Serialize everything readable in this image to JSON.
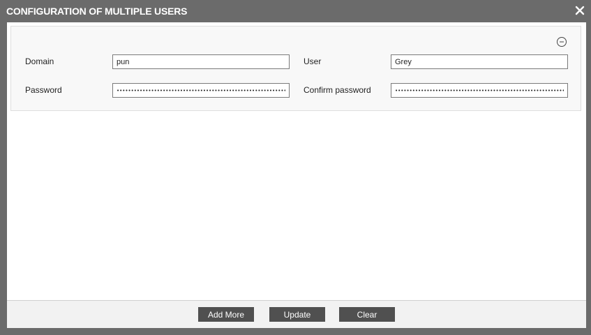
{
  "dialog": {
    "title": "CONFIGURATION OF MULTIPLE USERS",
    "close_icon": "close-icon"
  },
  "user_rows": [
    {
      "remove_icon": "minus-circle-icon",
      "domain_label": "Domain",
      "domain_value": "pun",
      "user_label": "User",
      "user_value": "Grey",
      "password_label": "Password",
      "password_value": "••••••••••••••••••••••••••••••••••••••••••••••••••••••••••••••••••••••",
      "confirm_label": "Confirm password",
      "confirm_value": "••••••••••••••••••••••••••••••••••••••••••••••••••••••••••••••••••••••"
    }
  ],
  "footer": {
    "add_more_label": "Add More",
    "update_label": "Update",
    "clear_label": "Clear"
  },
  "colors": {
    "frame": "#6b6b6b",
    "button": "#505050"
  }
}
